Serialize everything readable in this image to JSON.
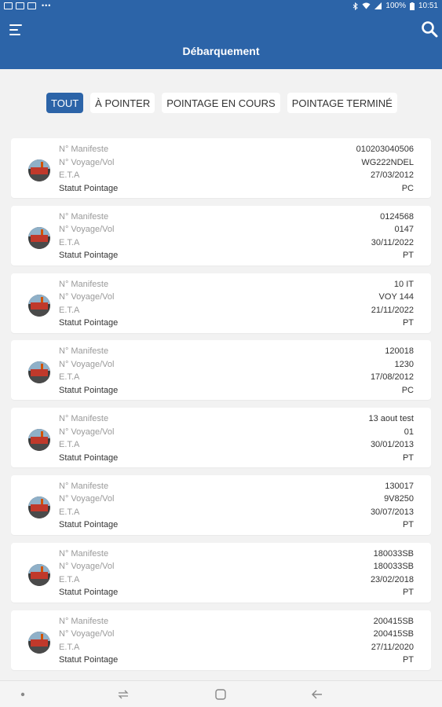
{
  "status_bar": {
    "dots": "•••",
    "battery_text": "100%",
    "time": "10:51"
  },
  "header": {
    "title": "Débarquement"
  },
  "tabs": [
    {
      "label": "TOUT",
      "active": true
    },
    {
      "label": "À POINTER",
      "active": false
    },
    {
      "label": "POINTAGE EN COURS",
      "active": false
    },
    {
      "label": "POINTAGE TERMINÉ",
      "active": false
    }
  ],
  "field_labels": {
    "manifeste": "N° Manifeste",
    "voyage": "N° Voyage/Vol",
    "eta": "E.T.A",
    "statut": "Statut Pointage"
  },
  "items": [
    {
      "manifeste": "010203040506",
      "voyage": "WG222NDEL",
      "eta": "27/03/2012",
      "statut": "PC"
    },
    {
      "manifeste": "0124568",
      "voyage": "0147",
      "eta": "30/11/2022",
      "statut": "PT"
    },
    {
      "manifeste": "10 IT",
      "voyage": "VOY 144",
      "eta": "21/11/2022",
      "statut": "PT"
    },
    {
      "manifeste": "120018",
      "voyage": "1230",
      "eta": "17/08/2012",
      "statut": "PC"
    },
    {
      "manifeste": "13 aout test",
      "voyage": "01",
      "eta": "30/01/2013",
      "statut": "PT"
    },
    {
      "manifeste": "130017",
      "voyage": "9V8250",
      "eta": "30/07/2013",
      "statut": "PT"
    },
    {
      "manifeste": "180033SB",
      "voyage": "180033SB",
      "eta": "23/02/2018",
      "statut": "PT"
    },
    {
      "manifeste": "200415SB",
      "voyage": "200415SB",
      "eta": "27/11/2020",
      "statut": "PT"
    }
  ],
  "icons": {
    "menu": "hamburger-menu-icon",
    "search": "search-icon",
    "avatar": "ship-port-thumbnail",
    "nav": [
      "nav-dot-icon",
      "recent-apps-icon",
      "home-icon",
      "back-icon"
    ]
  },
  "colors": {
    "primary": "#2c64a8",
    "background": "#f2f2f2",
    "card": "#ffffff",
    "label_gray": "#9a9a9a"
  }
}
